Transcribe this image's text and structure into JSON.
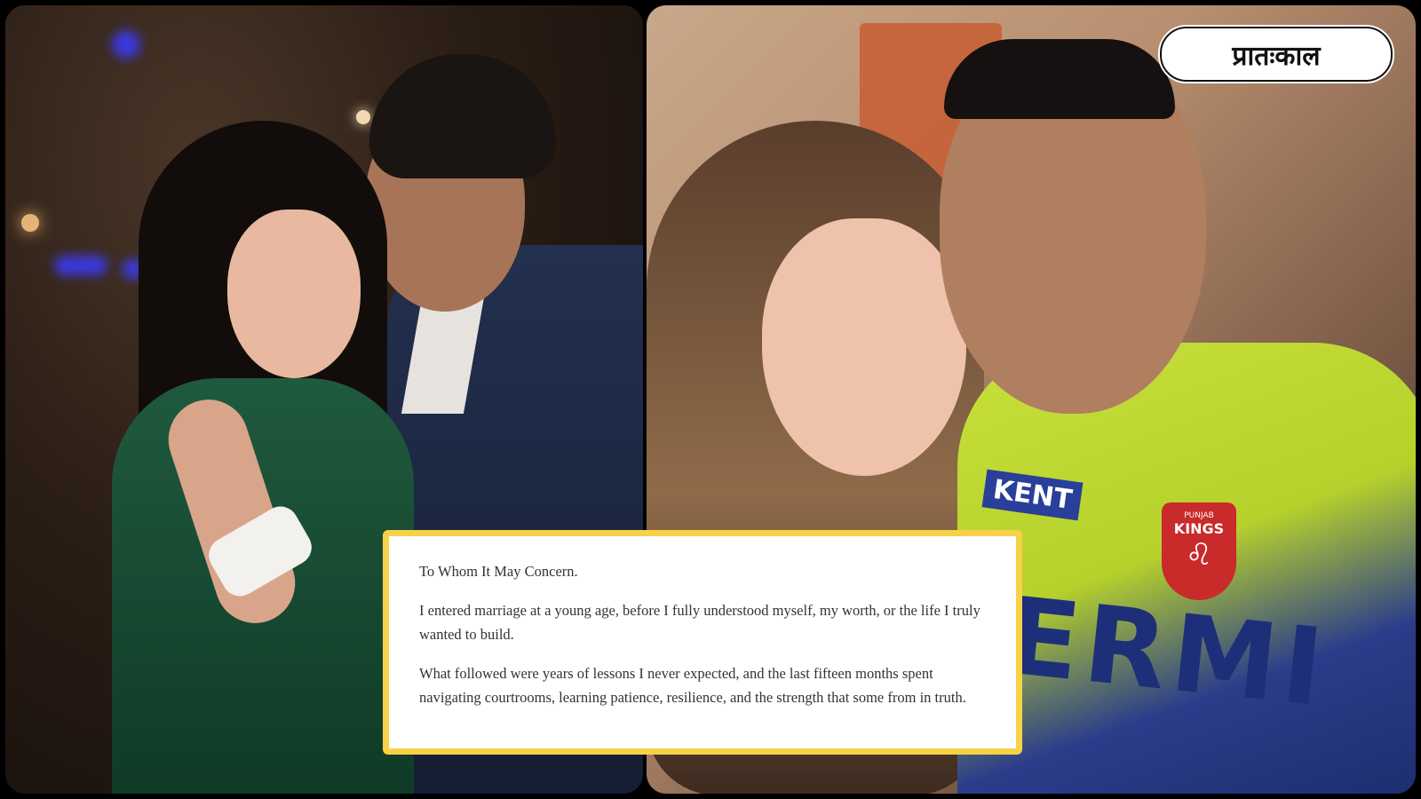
{
  "logo": {
    "text": "प्रातःकाल"
  },
  "letter": {
    "salutation": "To Whom It May Concern.",
    "paragraph_1": "I entered marriage at a young age, before I fully understood myself, my worth, or the life I truly wanted to build.",
    "paragraph_2": "What followed were years of lessons I never expected, and the last fifteen months spent navigating courtrooms, learning patience, resilience, and the strength that some from in truth."
  },
  "right_photo": {
    "sponsor": "KENT",
    "jersey_text": "ERMI",
    "crest_top": "PUNJAB",
    "crest_main": "KINGS",
    "crest_icon": "lion-icon"
  },
  "colors": {
    "letter_border": "#f7d148",
    "jersey_yellow": "#c8e03c",
    "jersey_blue": "#2b3d8a",
    "dress_green": "#1f5a3e",
    "crest_red": "#c92a2a"
  }
}
